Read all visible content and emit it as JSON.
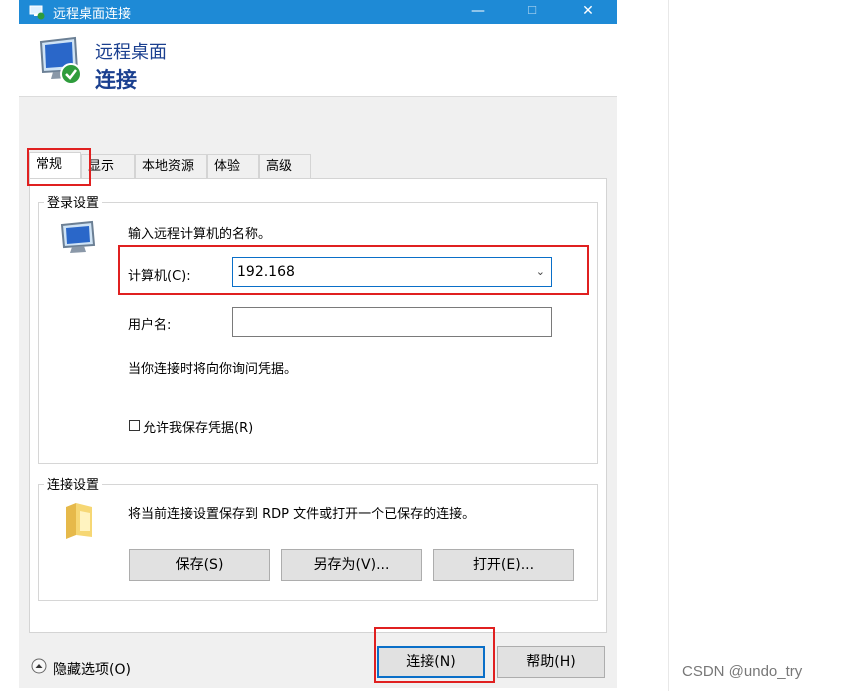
{
  "window": {
    "title": "远程桌面连接",
    "controls": {
      "minimize": "—",
      "maximize": "☐",
      "close": "✕"
    }
  },
  "header": {
    "line1": "远程桌面",
    "line2": "连接"
  },
  "tabs": [
    {
      "label": "常规",
      "active": true
    },
    {
      "label": "显示",
      "active": false
    },
    {
      "label": "本地资源",
      "active": false
    },
    {
      "label": "体验",
      "active": false
    },
    {
      "label": "高级",
      "active": false
    }
  ],
  "login": {
    "legend": "登录设置",
    "intro": "输入远程计算机的名称。",
    "computer_label": "计算机(C):",
    "computer_value": "192.168",
    "username_label": "用户名:",
    "username_value": "",
    "credential_note": "当你连接时将向你询问凭据。",
    "allow_save_label": "允许我保存凭据(R)",
    "allow_save_checked": false
  },
  "connection": {
    "legend": "连接设置",
    "description": "将当前连接设置保存到 RDP 文件或打开一个已保存的连接。",
    "save_button": "保存(S)",
    "save_as_button": "另存为(V)...",
    "open_button": "打开(E)..."
  },
  "footer": {
    "hide_options": "隐藏选项(O)",
    "connect_button": "连接(N)",
    "help_button": "帮助(H)"
  },
  "watermark": "CSDN @undo_try",
  "colors": {
    "titlebar": "#1e8ad6",
    "accent": "#0a6fc8",
    "highlight": "#e02020"
  }
}
